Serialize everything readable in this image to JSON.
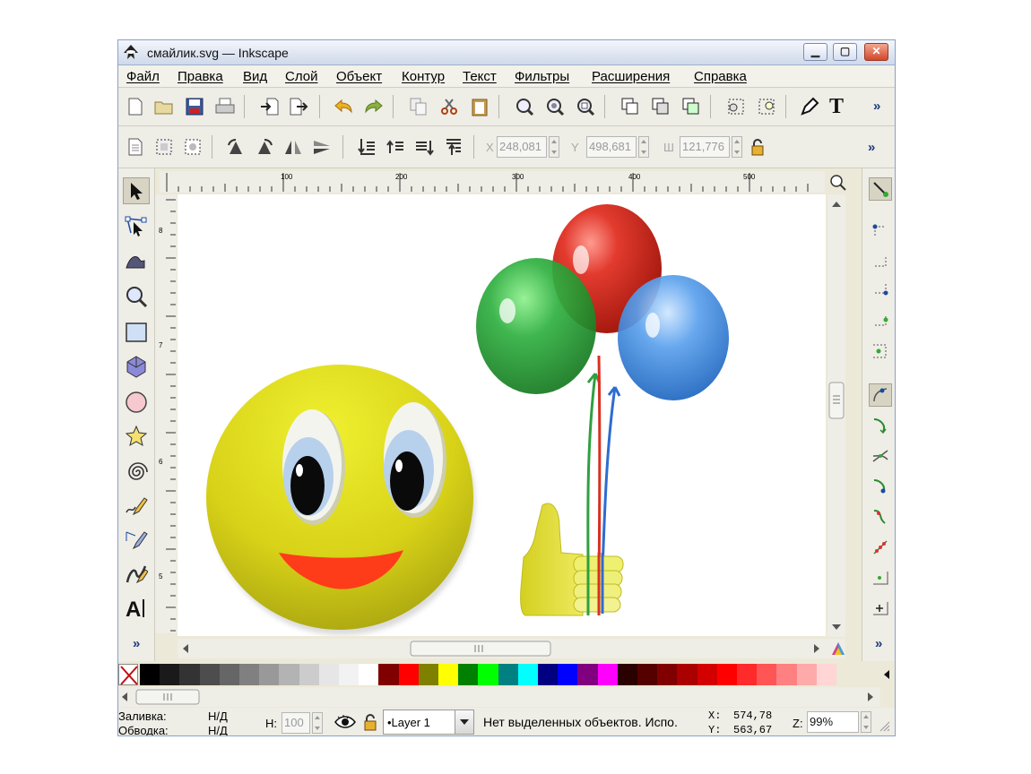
{
  "window": {
    "title": "смайлик.svg — Inkscape",
    "minimize": "▁",
    "maximize": "▢",
    "close": "✕"
  },
  "menu": [
    "Файл",
    "Правка",
    "Вид",
    "Слой",
    "Объект",
    "Контур",
    "Текст",
    "Фильтры",
    "Расширения",
    "Справка"
  ],
  "toolbar": {
    "overflow": "»"
  },
  "controls": {
    "x_label": "X",
    "x_value": "248,081",
    "y_label": "Y",
    "y_value": "498,681",
    "w_label": "Ш",
    "w_value": "121,776",
    "overflow": "»"
  },
  "ruler": {
    "h_ticks": [
      "100",
      "200",
      "300",
      "400",
      "500"
    ],
    "v_ticks": [
      "8",
      "7",
      "6",
      "5"
    ],
    "zoom_btn": "1:1"
  },
  "toolbox": {
    "overflow": "»"
  },
  "snap": {
    "overflow": "»"
  },
  "scroll": {
    "grip": "|||"
  },
  "palette": {
    "none_label": "none",
    "colors": [
      "#000000",
      "#1a1a1a",
      "#333333",
      "#4d4d4d",
      "#666666",
      "#808080",
      "#999999",
      "#b3b3b3",
      "#cccccc",
      "#e6e6e6",
      "#f2f2f2",
      "#ffffff",
      "#800000",
      "#ff0000",
      "#808000",
      "#ffff00",
      "#008000",
      "#00ff00",
      "#008080",
      "#00ffff",
      "#000080",
      "#0000ff",
      "#800080",
      "#ff00ff",
      "#2b0000",
      "#550000",
      "#800000",
      "#aa0000",
      "#d40000",
      "#ff0000",
      "#ff2a2a",
      "#ff5555",
      "#ff8080",
      "#ffaaaa",
      "#ffd5d5"
    ]
  },
  "status": {
    "fill_label": "Заливка:",
    "fill_value": "Н/Д",
    "stroke_label": "Обводка:",
    "stroke_value": "Н/Д",
    "h_label": "Н:",
    "h_value": "100",
    "layer": "•Layer 1",
    "message": "Нет выделенных объектов. Испо.",
    "x_label": "X:",
    "x_value": "574,78",
    "y_label": "Y:",
    "y_value": "563,67",
    "zoom_label": "Z:",
    "zoom_value": "99%"
  }
}
